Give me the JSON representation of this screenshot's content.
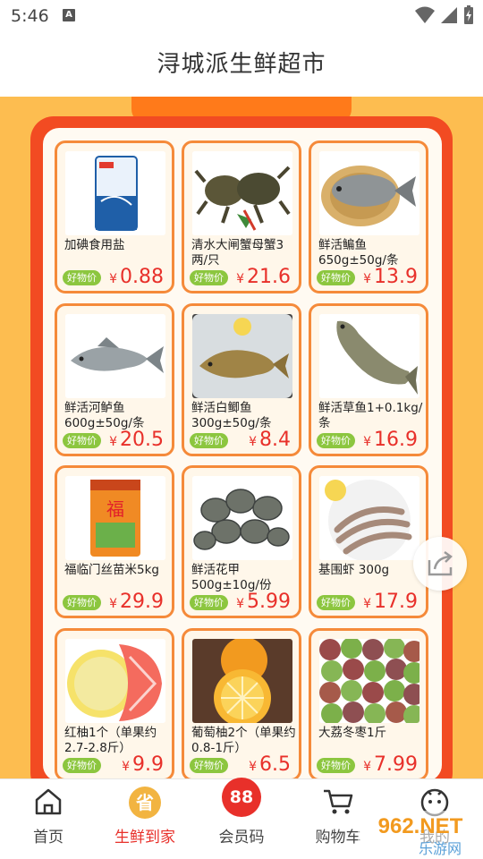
{
  "status_bar": {
    "time": "5:46",
    "notification_badge": "A"
  },
  "header": {
    "title": "浔城派生鲜超市"
  },
  "product_badge": "好物价",
  "currency": "¥",
  "products": [
    {
      "name": "加碘食用盐",
      "price": "0.88",
      "image": "salt-bag-image"
    },
    {
      "name": "清水大闸蟹母蟹3两/只",
      "price": "21.6",
      "image": "hairy-crab-image"
    },
    {
      "name": "鲜活鳊鱼650g±50g/条",
      "price": "13.9",
      "image": "bream-fish-image"
    },
    {
      "name": "鲜活河鲈鱼600g±50g/条",
      "price": "20.5",
      "image": "perch-fish-image"
    },
    {
      "name": "鲜活白鲫鱼300g±50g/条",
      "price": "8.4",
      "image": "crucian-carp-image"
    },
    {
      "name": "鲜活草鱼1+0.1kg/条",
      "price": "16.9",
      "image": "grass-carp-image"
    },
    {
      "name": "福临门丝苗米5kg",
      "price": "29.9",
      "image": "rice-bag-image"
    },
    {
      "name": "鲜活花甲500g±10g/份",
      "price": "5.99",
      "image": "clams-image"
    },
    {
      "name": "基围虾  300g",
      "price": "17.9",
      "image": "shrimp-image"
    },
    {
      "name": "红柚1个（单果约2.7-2.8斤）",
      "price": "9.9",
      "image": "red-pomelo-image"
    },
    {
      "name": "葡萄柚2个（单果约0.8-1斤）",
      "price": "6.5",
      "image": "grapefruit-image"
    },
    {
      "name": "大荔冬枣1斤",
      "price": "7.99",
      "image": "winter-jujube-image"
    }
  ],
  "nav": [
    {
      "label": "首页",
      "icon": "home-icon"
    },
    {
      "label": "生鲜到家",
      "icon": "fresh-delivery-icon",
      "icon_text": "省"
    },
    {
      "label": "会员码",
      "icon": "member-code-icon",
      "icon_text": "88"
    },
    {
      "label": "购物车",
      "icon": "cart-icon"
    },
    {
      "label": "我的",
      "icon": "profile-icon"
    }
  ],
  "watermark": {
    "line1": "962.NET",
    "line2": "乐游网"
  },
  "colors": {
    "accent": "#e8302a",
    "frame": "#f24b22",
    "background": "#fdbd50",
    "badge": "#8cc63f",
    "card_border": "#f58a3a"
  }
}
